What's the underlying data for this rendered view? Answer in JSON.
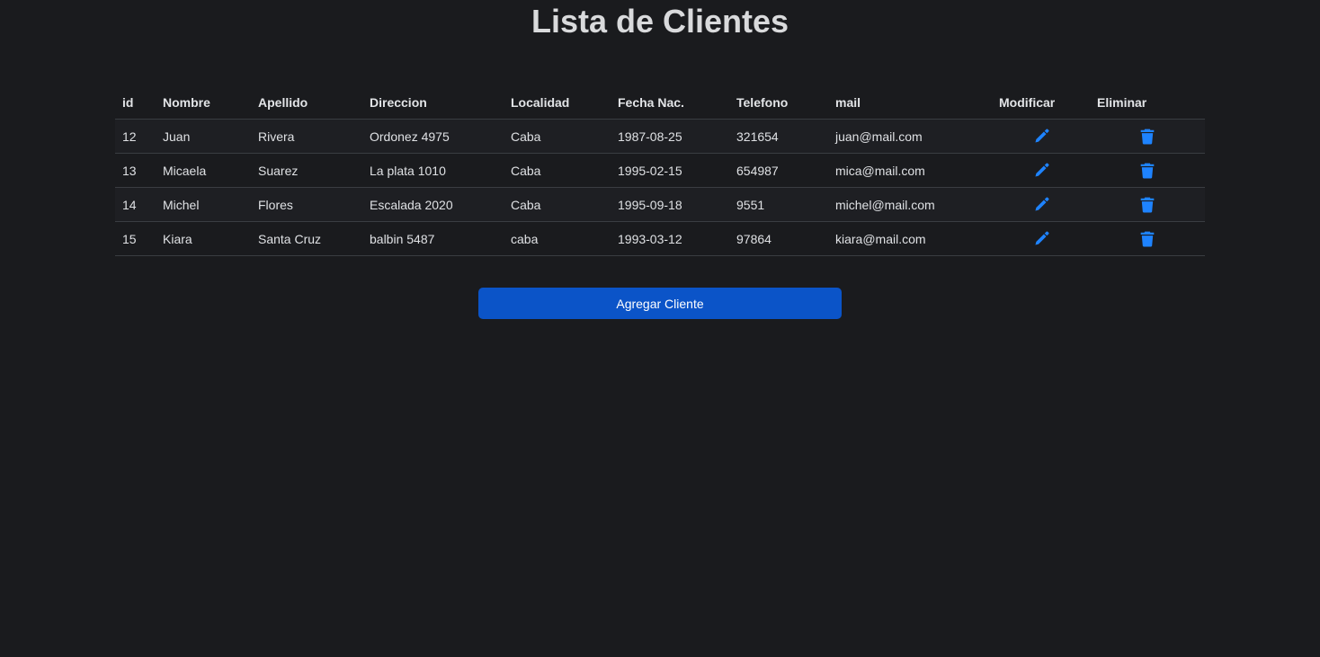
{
  "page": {
    "title": "Lista de Clientes"
  },
  "table": {
    "headers": [
      "id",
      "Nombre",
      "Apellido",
      "Direccion",
      "Localidad",
      "Fecha Nac.",
      "Telefono",
      "mail",
      "Modificar",
      "Eliminar"
    ],
    "rows": [
      {
        "id": "12",
        "nombre": "Juan",
        "apellido": "Rivera",
        "direccion": "Ordonez 4975",
        "localidad": "Caba",
        "fecha_nac": "1987-08-25",
        "telefono": "321654",
        "mail": "juan@mail.com"
      },
      {
        "id": "13",
        "nombre": "Micaela",
        "apellido": "Suarez",
        "direccion": "La plata 1010",
        "localidad": "Caba",
        "fecha_nac": "1995-02-15",
        "telefono": "654987",
        "mail": "mica@mail.com"
      },
      {
        "id": "14",
        "nombre": "Michel",
        "apellido": "Flores",
        "direccion": "Escalada 2020",
        "localidad": "Caba",
        "fecha_nac": "1995-09-18",
        "telefono": "9551",
        "mail": "michel@mail.com"
      },
      {
        "id": "15",
        "nombre": "Kiara",
        "apellido": "Santa Cruz",
        "direccion": "balbin 5487",
        "localidad": "caba",
        "fecha_nac": "1993-03-12",
        "telefono": "97864",
        "mail": "kiara@mail.com"
      }
    ],
    "icons": {
      "edit": "pencil-icon",
      "delete": "trash-icon"
    }
  },
  "actions": {
    "add_label": "Agregar Cliente"
  },
  "colors": {
    "background": "#1a1b1e",
    "accent": "#0b54c8",
    "icon": "#1e83ff"
  }
}
